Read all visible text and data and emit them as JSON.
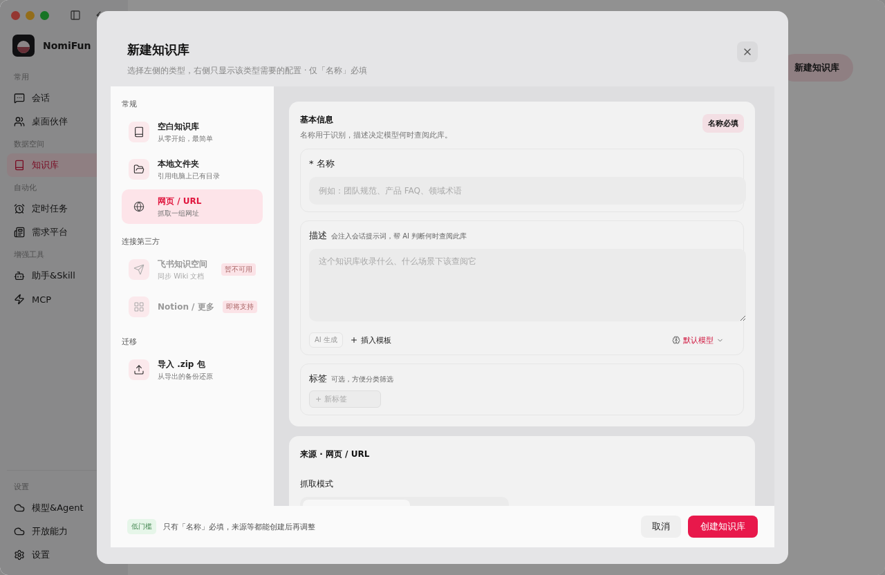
{
  "app": {
    "brand": "NomiFun",
    "header_button": "新建知识库",
    "nav_sections": [
      {
        "label": "常用",
        "items": [
          {
            "label": "会话",
            "selected": false
          },
          {
            "label": "桌面伙伴",
            "selected": false
          }
        ]
      },
      {
        "label": "数据空间",
        "items": [
          {
            "label": "知识库",
            "selected": true
          }
        ]
      },
      {
        "label": "自动化",
        "items": [
          {
            "label": "定时任务",
            "selected": false
          },
          {
            "label": "需求平台",
            "selected": false
          }
        ]
      },
      {
        "label": "增强工具",
        "items": [
          {
            "label": "助手&Skill",
            "selected": false
          },
          {
            "label": "MCP",
            "selected": false
          }
        ]
      }
    ],
    "settings_section": {
      "label": "设置",
      "items": [
        {
          "label": "模型&Agent",
          "selected": false
        },
        {
          "label": "开放能力",
          "selected": false
        },
        {
          "label": "设置",
          "selected": false
        }
      ]
    }
  },
  "dialog": {
    "title": "新建知识库",
    "subtitle": "选择左侧的类型，右侧只显示该类型需要的配置 · 仅「名称」必填",
    "type_groups": [
      {
        "label": "常规",
        "items": [
          {
            "title": "空白知识库",
            "subtitle": "从零开始，最简单",
            "selected": false,
            "disabled": false
          },
          {
            "title": "本地文件夹",
            "subtitle": "引用电脑上已有目录",
            "selected": false,
            "disabled": false
          },
          {
            "title": "网页 / URL",
            "subtitle": "抓取一组网址",
            "selected": true,
            "disabled": false
          }
        ]
      },
      {
        "label": "连接第三方",
        "items": [
          {
            "title": "飞书知识空间",
            "subtitle": "同步 Wiki 文档",
            "badge": "暂不可用",
            "selected": false,
            "disabled": true
          },
          {
            "title": "Notion / 更多",
            "badge": "即将支持",
            "selected": false,
            "disabled": true
          }
        ]
      },
      {
        "label": "迁移",
        "items": [
          {
            "title": "导入 .zip 包",
            "subtitle": "从导出的备份还原",
            "selected": false,
            "disabled": false
          }
        ]
      }
    ],
    "basic_info": {
      "title": "基本信息",
      "description": "名称用于识别，描述决定模型何时查阅此库。",
      "badge": "名称必填",
      "name_field": {
        "label": "* 名称",
        "placeholder": "例如：团队规范、产品 FAQ、领域术语"
      },
      "description_field": {
        "label": "描述",
        "hint": "会注入会话提示词，帮 AI 判断何时查阅此库",
        "placeholder": "这个知识库收录什么、什么场景下该查阅它",
        "ai_button": "AI 生成",
        "template_button": "插入模板",
        "model_button": "默认模型"
      },
      "tags_field": {
        "label": "标签",
        "hint": "可选，方便分类筛选",
        "add_button": "+ 新标签"
      }
    },
    "source": {
      "title": "来源 · 网页 / URL",
      "mode_label": "抓取模式"
    },
    "footer": {
      "badge": "低门槛",
      "note": "只有「名称」必填，来源等都能创建后再调整",
      "cancel": "取消",
      "submit": "创建知识库"
    }
  }
}
